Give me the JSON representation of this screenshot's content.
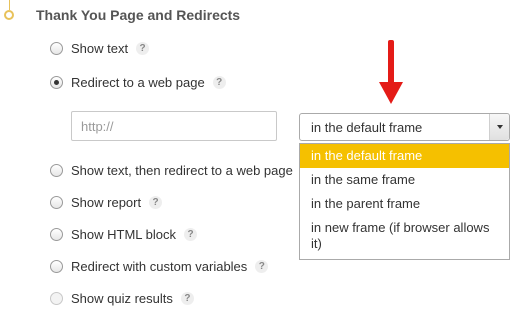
{
  "section": {
    "title": "Thank You Page and Redirects"
  },
  "help_glyph": "?",
  "options": [
    {
      "label": "Show text",
      "checked": false
    },
    {
      "label": "Redirect to a web page",
      "checked": true
    },
    {
      "label": "Show text, then redirect to a web page",
      "checked": false
    },
    {
      "label": "Show report",
      "checked": false
    },
    {
      "label": "Show HTML block",
      "checked": false
    },
    {
      "label": "Redirect with custom variables",
      "checked": false
    },
    {
      "label": "Show quiz results",
      "checked": false,
      "disabled": true
    }
  ],
  "url_field": {
    "placeholder": "http://",
    "value": ""
  },
  "frame_select": {
    "selected": "in the default frame",
    "options": [
      {
        "label": "in the default frame"
      },
      {
        "label": "in the same frame"
      },
      {
        "label": "in the parent frame"
      },
      {
        "label": "in new frame (if browser allows it)"
      }
    ]
  },
  "colors": {
    "accent": "#f5c000",
    "arrow": "#e41b17",
    "timeline": "#e8c25a"
  },
  "icons": {
    "annotation": "red-down-arrow-icon",
    "timeline": "timeline-dot-icon"
  }
}
